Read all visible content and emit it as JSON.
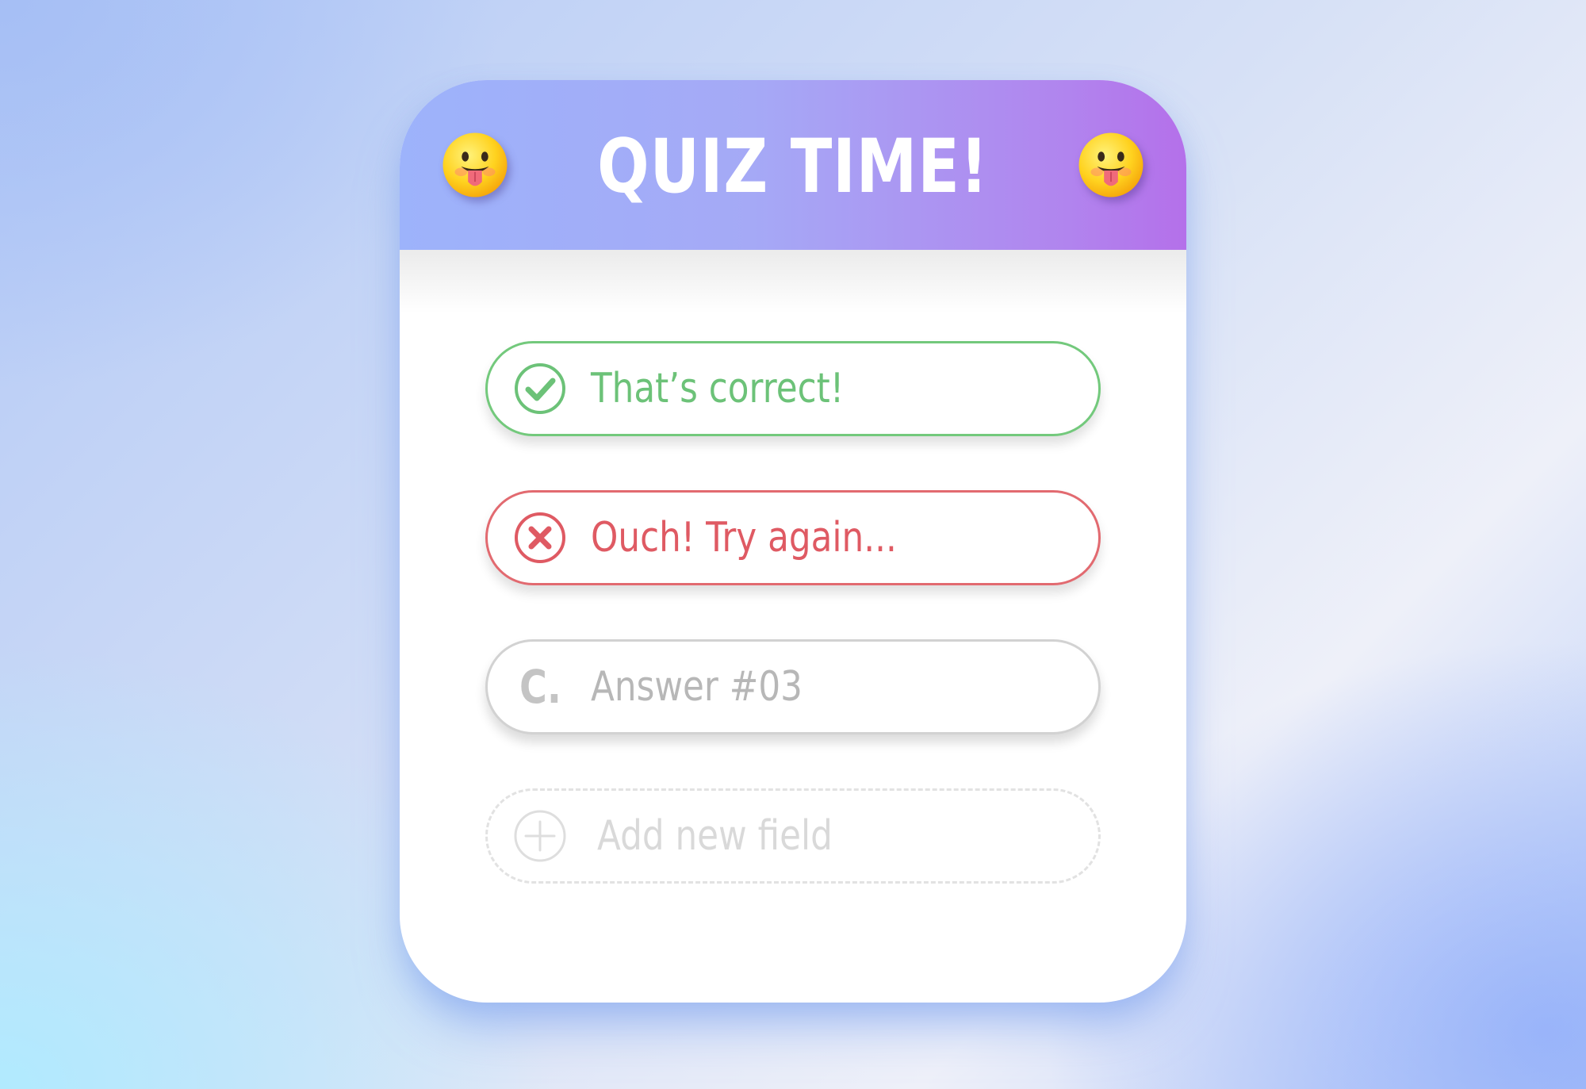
{
  "header": {
    "title": "QUIZ TIME!",
    "left_icon": "tongue-out-emoji-icon",
    "right_icon": "tongue-out-emoji-icon"
  },
  "answers": [
    {
      "state": "correct",
      "icon": "check-circle-icon",
      "text": "That’s correct!",
      "color": "#6cc278"
    },
    {
      "state": "wrong",
      "icon": "x-circle-icon",
      "text": "Ouch! Try again...",
      "color": "#df5a63"
    },
    {
      "state": "default",
      "letter": "C.",
      "text": "Answer #03",
      "color": "#b7b7b7"
    }
  ],
  "add_field": {
    "icon": "plus-circle-icon",
    "label": "Add new field"
  },
  "colors": {
    "header_start": "#9db3fb",
    "header_end": "#b470ea",
    "correct": "#73c97c",
    "wrong": "#e26a70",
    "neutral": "#d2d2d2"
  }
}
